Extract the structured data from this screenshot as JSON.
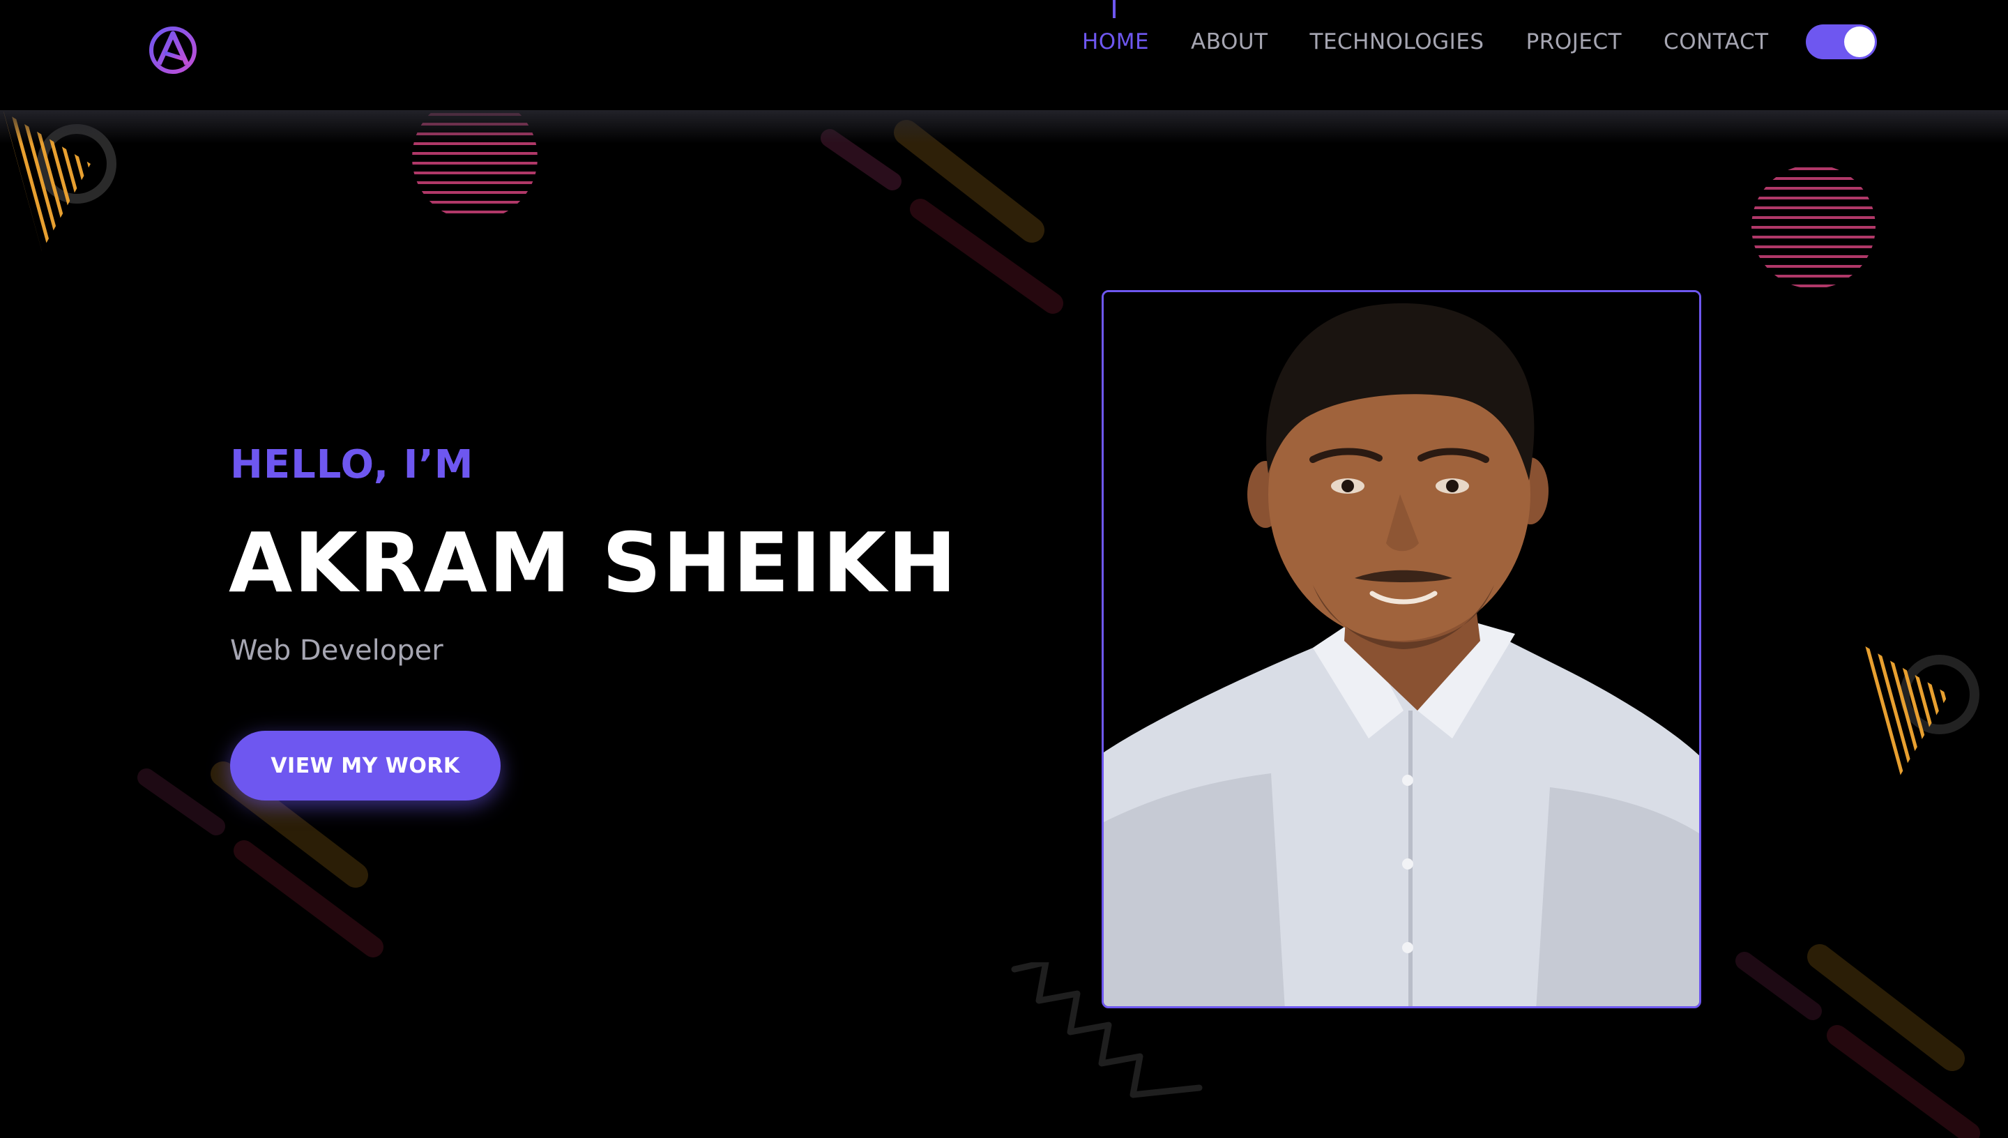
{
  "brand": {
    "logo_letter": "A",
    "accent_color": "#6e57f0"
  },
  "nav": {
    "items": [
      {
        "label": "HOME",
        "active": true
      },
      {
        "label": "ABOUT",
        "active": false
      },
      {
        "label": "TECHNOLOGIES",
        "active": false
      },
      {
        "label": "PROJECT",
        "active": false
      },
      {
        "label": "CONTACT",
        "active": false
      }
    ],
    "theme_toggle_on": true
  },
  "hero": {
    "greeting": "HELLO, I’M",
    "name": "AKRAM SHEIKH",
    "role": "Web Developer",
    "cta_label": "VIEW MY WORK"
  },
  "colors": {
    "background": "#000000",
    "accent": "#6e57f0",
    "nav_text": "#a6a6b2",
    "decor_orange": "#e8a030",
    "decor_pink": "#c2406e"
  }
}
